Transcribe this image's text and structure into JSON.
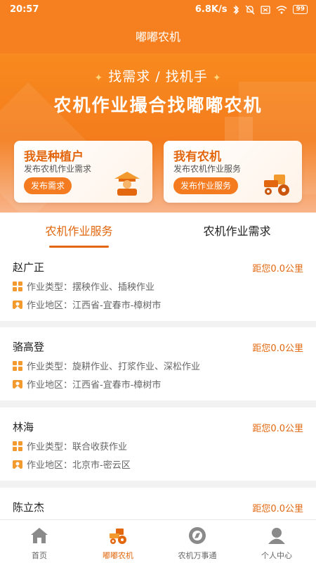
{
  "status": {
    "time": "20:57",
    "speed": "6.8K/s",
    "battery": "99"
  },
  "app": {
    "title": "嘟嘟农机"
  },
  "banner": {
    "sub_left": "找需求",
    "sub_sep": "/",
    "sub_right": "找机手",
    "headline": "农机作业撮合找嘟嘟农机"
  },
  "cards": [
    {
      "title": "我是种植户",
      "subtitle": "发布农机作业需求",
      "button": "发布需求",
      "icon": "farmer-icon"
    },
    {
      "title": "我有农机",
      "subtitle": "发布农机作业服务",
      "button": "发布作业服务",
      "icon": "tractor-icon"
    }
  ],
  "tabs": [
    {
      "label": "农机作业服务",
      "active": true
    },
    {
      "label": "农机作业需求",
      "active": false
    }
  ],
  "list": [
    {
      "name": "赵广正",
      "distance": "距您0.0公里",
      "type": "作业类型：摆秧作业、插秧作业",
      "area": "作业地区：江西省-宜春市-樟树市"
    },
    {
      "name": "骆高登",
      "distance": "距您0.0公里",
      "type": "作业类型：旋耕作业、打浆作业、深松作业",
      "area": "作业地区：江西省-宜春市-樟树市"
    },
    {
      "name": "林海",
      "distance": "距您0.0公里",
      "type": "作业类型：联合收获作业",
      "area": "作业地区：北京市-密云区"
    },
    {
      "name": "陈立杰",
      "distance": "距您0.0公里",
      "type": "",
      "area": ""
    }
  ],
  "nav": [
    {
      "label": "首页",
      "icon": "home-icon"
    },
    {
      "label": "嘟嘟农机",
      "icon": "tractor-icon"
    },
    {
      "label": "农机万事通",
      "icon": "compass-icon"
    },
    {
      "label": "个人中心",
      "icon": "user-icon"
    }
  ],
  "colors": {
    "primary": "#f6801f",
    "accent": "#e2670f"
  }
}
